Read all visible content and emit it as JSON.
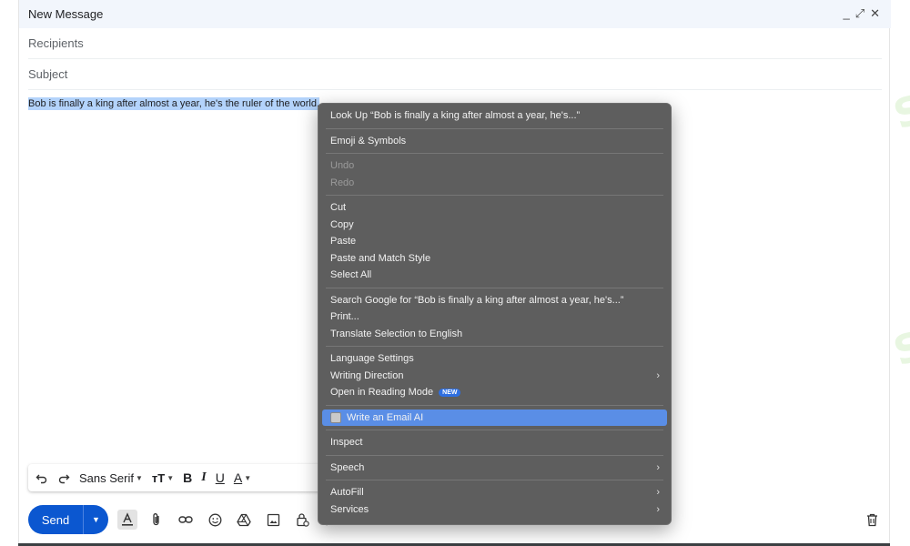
{
  "window": {
    "title": "New Message",
    "controls": {
      "minimize": "_",
      "expand": "⤢",
      "close": "✕"
    }
  },
  "fields": {
    "recipients_placeholder": "Recipients",
    "subject_placeholder": "Subject"
  },
  "body": {
    "text": "Bob is finally a king after almost a year, he's the ruler of the world."
  },
  "format_toolbar": {
    "undo_icon": "undo-icon",
    "redo_icon": "redo-icon",
    "font": "Sans Serif",
    "size_label": "тT",
    "bold": "B",
    "italic": "I",
    "underline": "U",
    "text_color": "A"
  },
  "bottom_bar": {
    "send_label": "Send",
    "accent_color": "#0b57d0"
  },
  "watermark": "AI TALENT SPACE",
  "context_menu": {
    "look_up": "Look Up “Bob is finally a king after almost a year, he's...”",
    "emoji": "Emoji & Symbols",
    "undo": "Undo",
    "redo": "Redo",
    "cut": "Cut",
    "copy": "Copy",
    "paste": "Paste",
    "paste_match": "Paste and Match Style",
    "select_all": "Select All",
    "search_google": "Search Google for “Bob is finally a king after almost a year, he's...”",
    "print": "Print...",
    "translate": "Translate Selection to English",
    "language_settings": "Language Settings",
    "writing_direction": "Writing Direction",
    "reading_mode": "Open in Reading Mode",
    "reading_mode_badge": "NEW",
    "write_email_ai": "Write an Email AI",
    "inspect": "Inspect",
    "speech": "Speech",
    "autofill": "AutoFill",
    "services": "Services",
    "submenu_arrow": "›",
    "highlight_color": "#5a8ee6"
  }
}
